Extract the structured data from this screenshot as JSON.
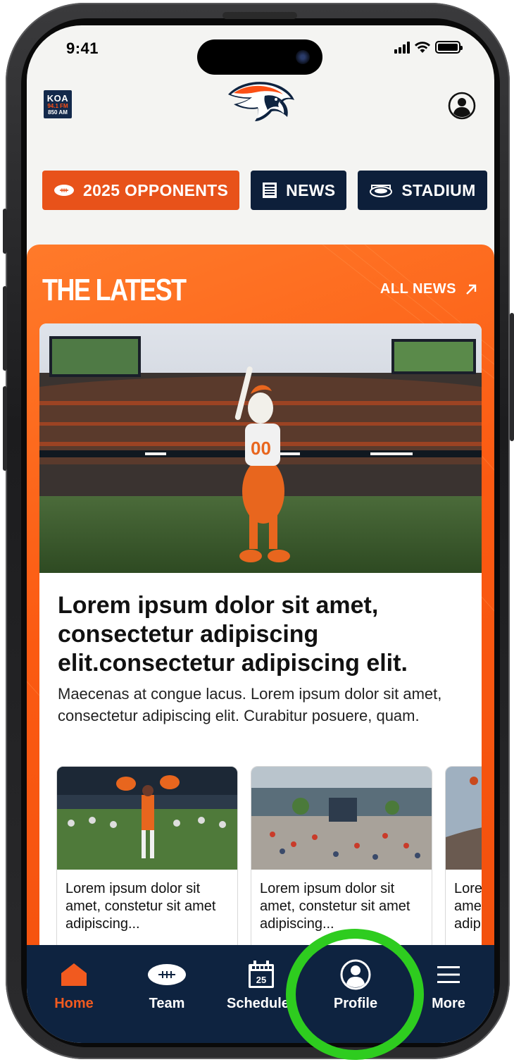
{
  "status_bar": {
    "time": "9:41"
  },
  "header": {
    "radio_logo": {
      "line1": "KOA",
      "line2": "94.1 FM",
      "line3": "850 AM"
    }
  },
  "chips": [
    {
      "label": "2025 OPPONENTS",
      "icon": "football-icon",
      "color": "#e8521a"
    },
    {
      "label": "NEWS",
      "icon": "newspaper-icon",
      "color": "#0d1f3a"
    },
    {
      "label": "STADIUM",
      "icon": "stadium-icon",
      "color": "#0d1f3a"
    }
  ],
  "latest": {
    "title": "THE LATEST",
    "all_news": "ALL NEWS",
    "featured": {
      "headline": "Lorem ipsum dolor sit amet, consectetur adipiscing elit.consectetur adipiscing elit.",
      "summary": "Maecenas at congue lacus. Lorem ipsum dolor sit amet, consectetur adipiscing elit. Curabitur posuere, quam."
    },
    "stories": [
      {
        "text": "Lorem ipsum dolor sit amet, constetur sit amet adipiscing..."
      },
      {
        "text": "Lorem ipsum dolor sit amet, constetur sit amet adipiscing..."
      },
      {
        "text": "Lorem ipsum dolor sit amet, constetur sit amet adipiscing..."
      }
    ]
  },
  "tabbar": {
    "items": [
      {
        "label": "Home",
        "icon": "home-icon",
        "active": true
      },
      {
        "label": "Team",
        "icon": "football-icon"
      },
      {
        "label": "Schedule",
        "icon": "calendar-icon",
        "calendar_day": "25"
      },
      {
        "label": "Profile",
        "icon": "profile-icon"
      },
      {
        "label": "More",
        "icon": "menu-icon"
      }
    ]
  },
  "colors": {
    "brand_orange": "#fb4f14",
    "brand_navy": "#0e2340",
    "highlight_ring": "#2ecc1f"
  }
}
